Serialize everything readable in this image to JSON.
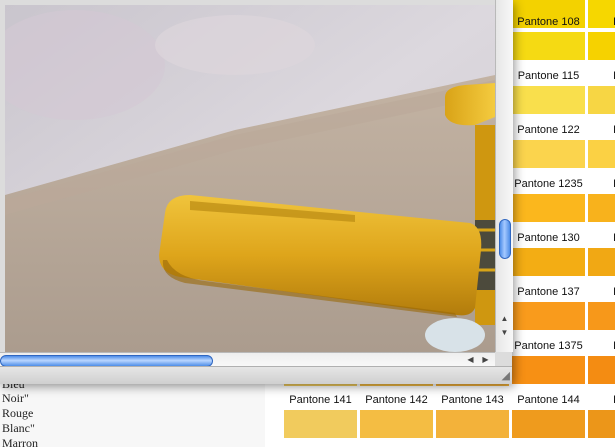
{
  "document": {
    "lines": [
      "Bleu",
      "Noir\"",
      "Rouge",
      "Blanc\"",
      "Marron"
    ]
  },
  "swatches": [
    {
      "label": "",
      "color": "#f3d200"
    },
    {
      "label": "",
      "color": "#f6d700"
    },
    {
      "label": "Pantone 108",
      "color": "#f5da13"
    },
    {
      "label": "Pant",
      "color": "#f6d200"
    },
    {
      "label": "Pantone 115",
      "color": "#f9df4c"
    },
    {
      "label": "Pant",
      "color": "#f7d644"
    },
    {
      "label": "Pantone 122",
      "color": "#fbd44d"
    },
    {
      "label": "Pant",
      "color": "#fbd144"
    },
    {
      "label": "Pantone 1235",
      "color": "#fbb71d"
    },
    {
      "label": "Pant",
      "color": "#f8b21c"
    },
    {
      "label": "Pantone 130",
      "color": "#f3ad14"
    },
    {
      "label": "Pant",
      "color": "#f1a814"
    },
    {
      "label": "Pantone 137",
      "color": "#f99b1c"
    },
    {
      "label": "Pant",
      "color": "#f7981a"
    },
    {
      "label": "Pantone 1375",
      "color": "#f79014"
    },
    {
      "label": "Pant",
      "color": "#f48c12"
    },
    {
      "label": "Pantone 141",
      "color": "#f1cb5d"
    },
    {
      "label": "Pantone 142",
      "color": "#f4bd43"
    },
    {
      "label": "Pantone 143",
      "color": "#f3b23a"
    },
    {
      "label": "Pantone 144",
      "color": "#ef9b1d"
    },
    {
      "label": "Pant",
      "color": "#ec9619"
    }
  ],
  "viewer": {
    "scrollbar_v": {
      "up": "▲",
      "down": "▼"
    },
    "scrollbar_h": {
      "left": "◀",
      "right": "▶"
    },
    "resize_glyph": "◢"
  }
}
